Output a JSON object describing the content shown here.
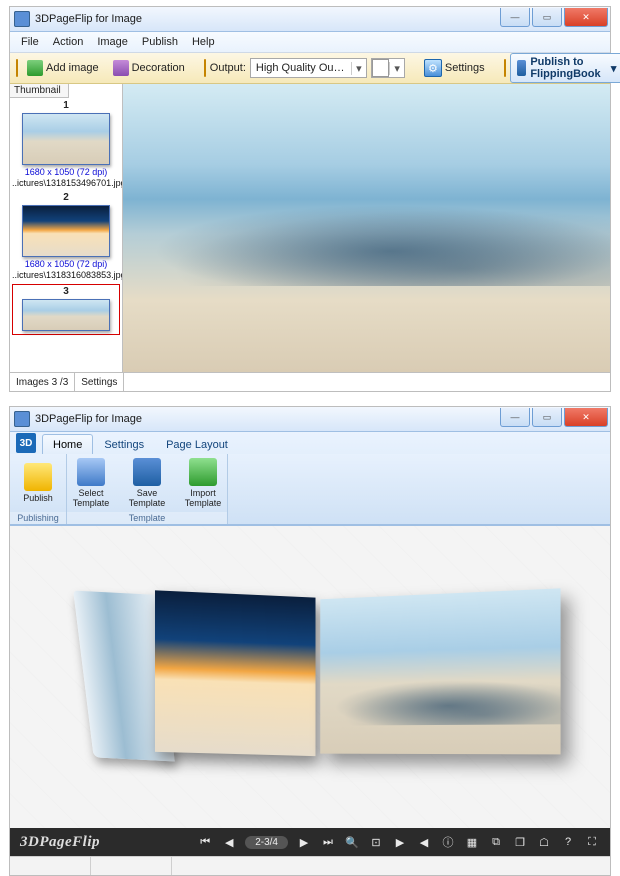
{
  "app": {
    "title": "3DPageFlip for Image"
  },
  "menus": [
    "File",
    "Action",
    "Image",
    "Publish",
    "Help"
  ],
  "toolbar": {
    "add_image": "Add image",
    "decoration": "Decoration",
    "output_label": "Output:",
    "output_value": "High Quality Output",
    "settings": "Settings",
    "publish": "Publish to FlippingBook",
    "help_glyph": "?"
  },
  "sidebar": {
    "tab": "Thumbnail",
    "items": [
      {
        "num": "1",
        "meta": "1680 x 1050 (72 dpi)",
        "file": "..ictures\\1318153496701.jpg",
        "kind": "sky"
      },
      {
        "num": "2",
        "meta": "1680 x 1050 (72 dpi)",
        "file": "..ictures\\1318316083853.jpg",
        "kind": "sunset"
      },
      {
        "num": "3",
        "meta": "",
        "file": "",
        "kind": "sky",
        "selected": true
      }
    ]
  },
  "status": {
    "images": "Images 3 /3",
    "settings": "Settings"
  },
  "win2": {
    "tabs": [
      "Home",
      "Settings",
      "Page Layout"
    ],
    "active_tab": 0,
    "logo_text": "3D",
    "groups": [
      {
        "caption": "Publishing",
        "buttons": [
          {
            "label": "Publish",
            "icon": "pub"
          }
        ]
      },
      {
        "caption": "Template",
        "buttons": [
          {
            "label": "Select Template",
            "icon": "sel"
          },
          {
            "label": "Save Template",
            "icon": "save"
          },
          {
            "label": "Import Template",
            "icon": "imp"
          }
        ]
      }
    ],
    "brand": "3DPageFlip",
    "pager": "2-3/4",
    "controls": [
      "first",
      "prev",
      "pager",
      "next",
      "last",
      "zoom-in",
      "zoom-out",
      "play",
      "sound",
      "info",
      "thumbs",
      "screenshot",
      "share",
      "print",
      "help",
      "fullscreen"
    ]
  },
  "win_controls": {
    "min": "—",
    "max": "▭",
    "close": "✕"
  }
}
